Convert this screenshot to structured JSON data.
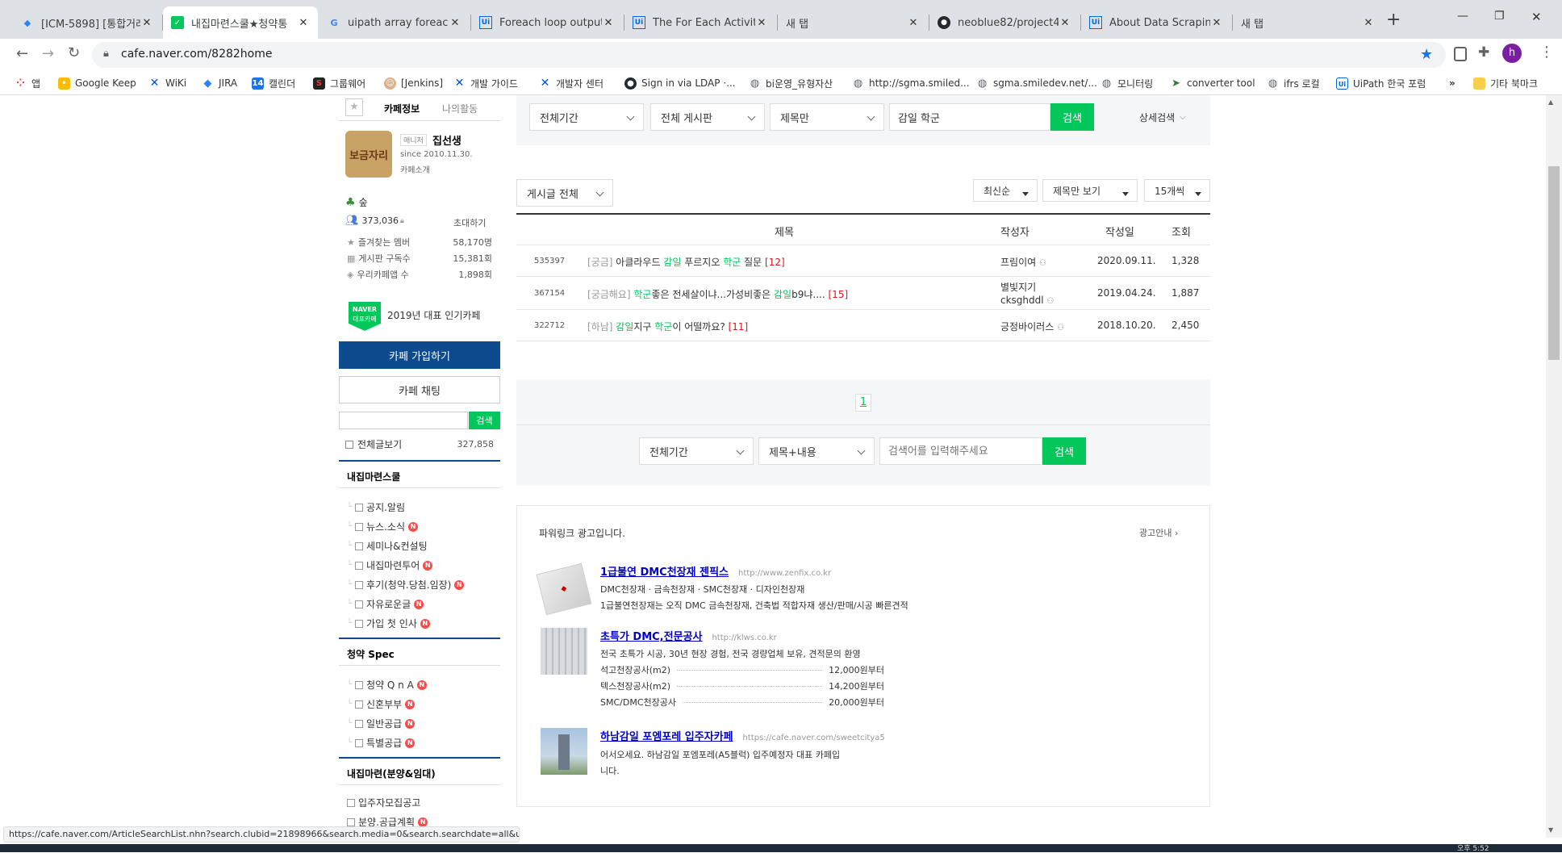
{
  "browser": {
    "tabs": [
      {
        "title": "[ICM-5898] [통합거래처",
        "icon_name": "jira-icon",
        "icon_color": "#2684ff"
      },
      {
        "title": "내집마련스쿨★청약통",
        "icon_name": "naver-cafe-icon",
        "icon_color": "#03c75a"
      },
      {
        "title": "uipath array foreach -",
        "icon_name": "google-icon",
        "icon_color": "#4285f4"
      },
      {
        "title": "Foreach loop output a",
        "icon_name": "uipath-icon",
        "icon_color": "#0067df"
      },
      {
        "title": "The For Each Activity",
        "icon_name": "uipath-icon",
        "icon_color": "#0067df"
      },
      {
        "title": "새 탭",
        "icon_name": "",
        "icon_color": ""
      },
      {
        "title": "neoblue82/project4K_i",
        "icon_name": "github-icon",
        "icon_color": "#24292e"
      },
      {
        "title": "About Data Scraping",
        "icon_name": "uipath-icon",
        "icon_color": "#0067df"
      },
      {
        "title": "새 탭",
        "icon_name": "",
        "icon_color": ""
      }
    ],
    "new_tab_symbol": "+",
    "url": "cafe.naver.com/8282home",
    "profile_letter": "h",
    "bookmarks": [
      {
        "label": "앱",
        "icon_name": "apps-icon",
        "color": "#ea4335"
      },
      {
        "label": "Google Keep",
        "icon_name": "keep-icon",
        "color": "#fbbc04"
      },
      {
        "label": "WiKi",
        "icon_name": "confluence-icon",
        "color": "#0052cc"
      },
      {
        "label": "JIRA",
        "icon_name": "jira-icon",
        "color": "#2684ff"
      },
      {
        "label": "캘린더",
        "icon_name": "calendar-icon",
        "color": "#1a73e8"
      },
      {
        "label": "그룹웨어",
        "icon_name": "groupware-icon",
        "color": "#d93025"
      },
      {
        "label": "[Jenkins]",
        "icon_name": "jenkins-icon",
        "color": "#d24939"
      },
      {
        "label": "개발 가이드",
        "icon_name": "confluence-icon",
        "color": "#0052cc"
      },
      {
        "label": "개발자 센터",
        "icon_name": "confluence-icon",
        "color": "#0052cc"
      },
      {
        "label": "Sign in via LDAP ·...",
        "icon_name": "github-icon",
        "color": "#24292e"
      },
      {
        "label": "bi운영_유형자산",
        "icon_name": "globe-icon",
        "color": "#5f6368"
      },
      {
        "label": "http://sgma.smiled...",
        "icon_name": "globe-icon",
        "color": "#5f6368"
      },
      {
        "label": "sgma.smiledev.net/...",
        "icon_name": "globe-icon",
        "color": "#5f6368"
      },
      {
        "label": "모니터링",
        "icon_name": "globe-icon",
        "color": "#5f6368"
      },
      {
        "label": "converter tool",
        "icon_name": "converter-icon",
        "color": "#2e7d32"
      },
      {
        "label": "ifrs 로컬",
        "icon_name": "globe-icon",
        "color": "#5f6368"
      },
      {
        "label": "UiPath 한국 포럼",
        "icon_name": "uipath-icon",
        "color": "#0067df"
      }
    ],
    "more_bookmarks": "»",
    "other_bookmarks": "기타 북마크",
    "status_url": "https://cafe.naver.com/ArticleSearchList.nhn?search.clubid=21898966&search.media=0&search.searchdate=all&us...",
    "clock": "오후 5:52"
  },
  "sidebar": {
    "tab_cafe_info": "카페정보",
    "tab_my_activity": "나의활동",
    "cafe_logo_text": "보금자리",
    "manager_badge": "매니저",
    "manager_name": "집선생",
    "since": "since 2010.11.30.",
    "cafe_intro_link": "카페소개",
    "level_name": "숲",
    "member_count": "373,036",
    "invite_label": "초대하기",
    "stats": [
      {
        "label": "즐겨찾는 멤버",
        "value": "58,170명"
      },
      {
        "label": "게시판 구독수",
        "value": "15,381회"
      },
      {
        "label": "우리카페앱 수",
        "value": "1,898회"
      }
    ],
    "naver_badge_top": "NAVER",
    "naver_badge_bottom": "대표카페",
    "award_text": "2019년 대표 인기카페",
    "join_button": "카페 가입하기",
    "chat_button": "카페 채팅",
    "search_button": "검색",
    "all_posts_label": "전체글보기",
    "all_posts_count": "327,858",
    "section1_title": "내집마련스쿨",
    "section1_items": [
      {
        "label": "공지.알림",
        "new": false
      },
      {
        "label": "뉴스.소식",
        "new": true
      },
      {
        "label": "세미나&컨설팅",
        "new": false
      },
      {
        "label": "내집마련투어",
        "new": true
      },
      {
        "label": "후기(청약.당첨.임장)",
        "new": true
      },
      {
        "label": "자유로운글",
        "new": true
      },
      {
        "label": "가입 첫 인사",
        "new": true
      }
    ],
    "section2_title": "청약 Spec",
    "section2_items": [
      {
        "label": "청약 Q n A",
        "new": true
      },
      {
        "label": "신혼부부",
        "new": true
      },
      {
        "label": "일반공급",
        "new": true
      },
      {
        "label": "특별공급",
        "new": true
      }
    ],
    "section3_title": "내집마련(분양&임대)",
    "section3_items": [
      {
        "label": "입주자모집공고",
        "new": false
      },
      {
        "label": "분양.공급계획",
        "new": true
      }
    ],
    "new_badge": "N"
  },
  "search_top": {
    "period": "전체기간",
    "board": "전체 게시판",
    "scope": "제목만",
    "query": "감일 학군",
    "search_button": "검색",
    "detail_search": "상세검색"
  },
  "list_controls": {
    "filter": "게시글 전체",
    "sort": "최신순",
    "view": "제목만 보기",
    "per_page": "15개씩"
  },
  "table": {
    "headers": {
      "title": "제목",
      "author": "작성자",
      "date": "작성일",
      "views": "조회"
    },
    "rows": [
      {
        "id": "535397",
        "prefix": "[궁금]",
        "t1": "아클라우드 ",
        "h1": "감일",
        "t2": " 푸르지오 ",
        "h2": "학군",
        "t3": " 질문",
        "t4": "",
        "comments": "[12]",
        "author": "프림이여",
        "author2": "",
        "date": "2020.09.11.",
        "views": "1,328"
      },
      {
        "id": "367154",
        "prefix": "[궁금해요]",
        "t1": "",
        "h1": "학군",
        "t2": "좋은 전세살이냐...가성비좋은 ",
        "h2": "감일",
        "t3": "b9냐....",
        "t4": "",
        "comments": "[15]",
        "author": "별빛지기",
        "author2": "cksghddl",
        "date": "2019.04.24.",
        "views": "1,887"
      },
      {
        "id": "322712",
        "prefix": "[하남]",
        "t1": "",
        "h1": "감일",
        "t2": "지구 ",
        "h2": "학군",
        "t3": "이 어떨까요?",
        "t4": "",
        "comments": "[11]",
        "author": "긍정바이러스",
        "author2": "",
        "date": "2018.10.20.",
        "views": "2,450"
      }
    ]
  },
  "pagination": {
    "current": "1"
  },
  "search_bottom": {
    "period": "전체기간",
    "scope": "제목+내용",
    "placeholder": "검색어를 입력해주세요",
    "search_button": "검색"
  },
  "ads": {
    "header": "파워링크 광고입니다.",
    "guide": "광고안내",
    "items": [
      {
        "title": "1급불연 DMC천장재 젠픽스",
        "url": "http://www.zenfix.co.kr",
        "tags": [
          "DMC천장재",
          "금속천장재",
          "SMC천장재",
          "디자인천장재"
        ],
        "desc": "1급불연천장재는 오직 DMC 금속천장재, 건축법 적합자재 생산/판매/시공 빠른견적",
        "prices": []
      },
      {
        "title": "초특가 DMC,전문공사",
        "url": "http://klws.co.kr",
        "tags": [],
        "desc": "전국 초특가 시공, 30년 현장 경험, 전국 경량업체 보유, 견적문의 환영",
        "prices": [
          {
            "label": "석고천장공사(m2)",
            "value": "12,000원부터"
          },
          {
            "label": "텍스천장공사(m2)",
            "value": "14,200원부터"
          },
          {
            "label": "SMC/DMC천장공사",
            "value": "20,000원부터"
          }
        ]
      },
      {
        "title": "하남감일 포엠포레 입주자카페",
        "url": "https://cafe.naver.com/sweetcitya5",
        "tags": [],
        "desc": "어서오세요. 하남감일 포엠포레(A5블럭) 입주예정자 대표 카페입니다.",
        "prices": []
      }
    ]
  },
  "colors": {
    "naver_green": "#03c75a",
    "join_button": "#0e4a8e",
    "section_line": "#0e4a8e",
    "comment_red": "#e01414",
    "new_badge": "#ff4a4a"
  }
}
